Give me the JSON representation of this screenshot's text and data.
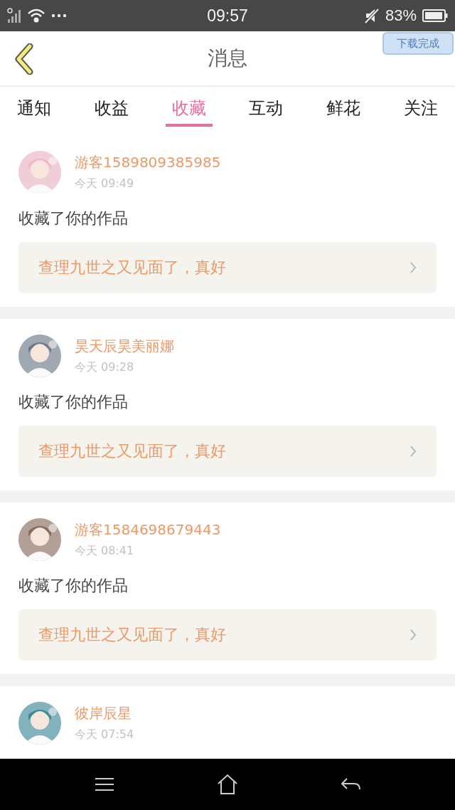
{
  "status_bar": {
    "time": "09:57",
    "battery": "83%"
  },
  "header": {
    "title": "消息",
    "toast": "下载完成"
  },
  "tabs": [
    {
      "label": "通知",
      "selected": false
    },
    {
      "label": "收益",
      "selected": false
    },
    {
      "label": "收藏",
      "selected": true
    },
    {
      "label": "互动",
      "selected": false
    },
    {
      "label": "鲜花",
      "selected": false
    },
    {
      "label": "关注",
      "selected": false
    }
  ],
  "messages": [
    {
      "user": "游客1589809385985",
      "time": "今天 09:49",
      "action": "收藏了你的作品",
      "work": "查理九世之又见面了，真好"
    },
    {
      "user": "昊天辰昊美丽娜",
      "time": "今天 09:28",
      "action": "收藏了你的作品",
      "work": "查理九世之又见面了，真好"
    },
    {
      "user": "游客1584698679443",
      "time": "今天 08:41",
      "action": "收藏了你的作品",
      "work": "查理九世之又见面了，真好"
    },
    {
      "user": "彼岸辰星",
      "time": "今天 07:54"
    }
  ]
}
